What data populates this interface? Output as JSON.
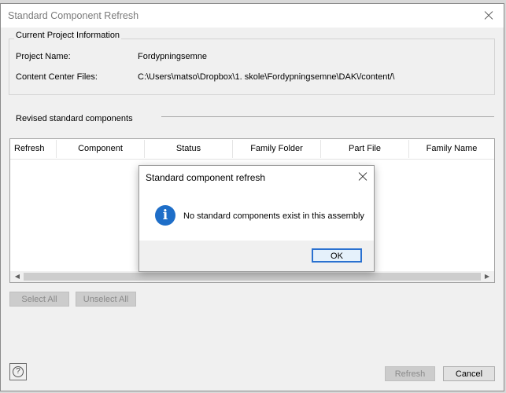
{
  "window": {
    "title": "Standard Component Refresh"
  },
  "project_info": {
    "legend": "Current Project Information",
    "project_name_label": "Project Name:",
    "project_name_value": "Fordypningsemne",
    "content_center_label": "Content Center Files:",
    "content_center_value": "C:\\Users\\matso\\Dropbox\\1. skole\\Fordypningsemne\\DAK\\/content/\\"
  },
  "revised_section": {
    "label": "Revised standard components"
  },
  "table": {
    "columns": [
      "Refresh",
      "Component",
      "Status",
      "Family Folder",
      "Part File",
      "Family Name"
    ],
    "scroll_left": "◀",
    "scroll_right": "▶"
  },
  "buttons": {
    "select_all": "Select All",
    "unselect_all": "Unselect All",
    "refresh": "Refresh",
    "cancel": "Cancel",
    "help": "?"
  },
  "message_box": {
    "title": "Standard component refresh",
    "icon_glyph": "i",
    "text": "No standard components exist in this assembly",
    "ok": "OK",
    "accent_color": "#1e6ec8"
  }
}
